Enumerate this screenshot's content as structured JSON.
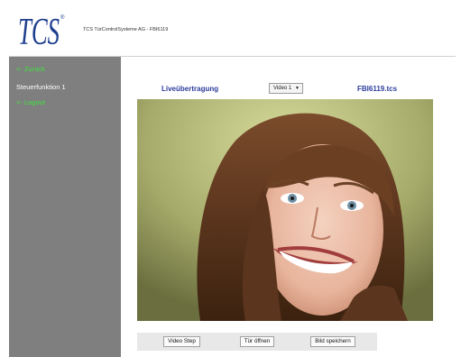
{
  "header": {
    "logo_text": "TCS",
    "title": "TCS TürControlSysteme AG - FBI6119"
  },
  "sidebar": {
    "items": [
      {
        "label": "<- Zurück",
        "link": true
      },
      {
        "label": "Steuerfunktion 1",
        "link": false
      },
      {
        "label": "<- Logout",
        "link": true
      }
    ]
  },
  "main": {
    "live_label": "Liveübertragung",
    "video_select": {
      "selected": "Video 1"
    },
    "file_label": "FBI6119.tcs",
    "image_alt": "Live-Video: lächelnde Frau"
  },
  "toolbar": {
    "video_step": "Video Step",
    "open_door": "Tür öffnen",
    "save_image": "Bild speichern"
  },
  "colors": {
    "sidebar_bg": "#7f7f7f",
    "link_green": "#3fe43f",
    "heading_blue": "#2c3d9b",
    "logo_blue": "#1f3f8f"
  }
}
